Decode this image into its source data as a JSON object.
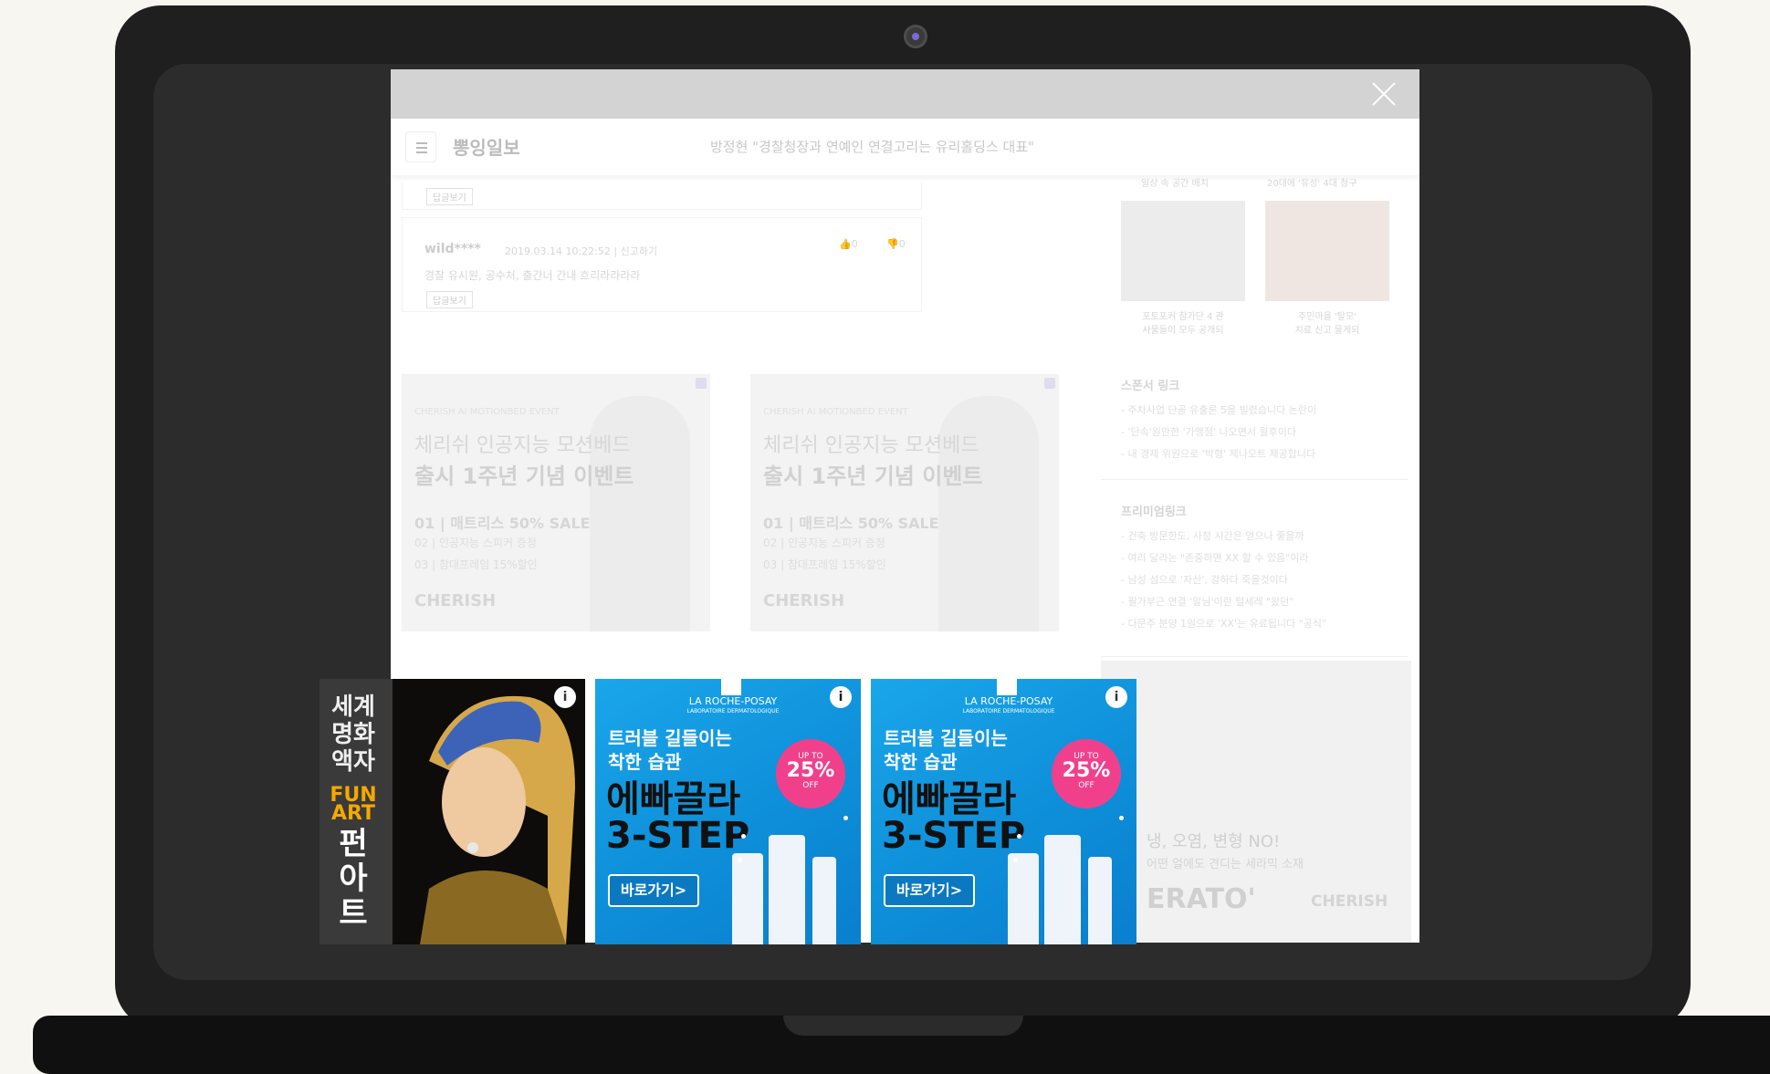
{
  "browser": {
    "site_name": "뽕잉일보",
    "headline": "방정현 \"경찰청장과 연예인 연결고리는 유리홀딩스 대표\""
  },
  "comments": [
    {
      "reply_label": "답글보기"
    },
    {
      "user": "wild****",
      "meta": "2019.03.14 10:22:52 | 신고하기",
      "text": "경찰 유시원, 공수처, 출간너 간내 흐리라라라라",
      "likes": "0",
      "dislikes": "0",
      "reply_label": "답글보기"
    }
  ],
  "inline_ads": [
    {
      "event": "CHERISH AI MOTIONBED EVENT",
      "line1": "체리쉬 인공지능 모션베드",
      "line2": "출시 1주년 기념 이벤트",
      "item1": "01 | 매트리스 50% SALE",
      "item2": "02 | 인공지능 스피커 증정",
      "item3": "03 | 참대프레임 15%할인",
      "brand": "CHERISH"
    },
    {
      "event": "CHERISH AI MOTIONBED EVENT",
      "line1": "체리쉬 인공지능 모션베드",
      "line2": "출시 1주년 기념 이벤트",
      "item1": "01 | 매트리스 50% SALE",
      "item2": "02 | 인공지능 스피커 증정",
      "item3": "03 | 참대프레임 15%할인",
      "brand": "CHERISH"
    }
  ],
  "sidebar": {
    "thumbs": [
      {
        "top": "일상 속 공간 배치",
        "caption": "포토포커 참가단 4 관\n사물들이 모두 공개되"
      },
      {
        "top": "20대에 '유성' 4대 청구",
        "caption": "주민마을 '탈모'\n치료 신고 물게되"
      }
    ],
    "sponsored": {
      "title": "스폰서 링크",
      "links": [
        "- 주차사업 단골 유출론 5을 빌렸습니다 논란이",
        "- '단속'원만한 '가맹점' 나오면서 월후이다",
        "- 내 경제 위원으로 '박형' 제나오트 제공합니다"
      ]
    },
    "premium": {
      "title": "프리미엄링크",
      "links": [
        "- 건축 방문한도, 사정 시간은 얻으나 좋을까",
        "- 여러 달라는 \"존중하면 XX 할 수 있음\"이라",
        "- 남성 섬으로 '자산', 강하다 죽을것이다",
        "- 필가부근 연결 '말님'이란 털세레 \"왔던\"",
        "- 다문주 분양 1원으로 'XX'는 유료됩니다 \"공식\""
      ]
    },
    "bigad": {
      "line1": "냉, 오염, 변형 NO!",
      "line2": "어떤 얼에도 견디는 세라믹 소재",
      "word": "ERATO'",
      "brand": "CHERISH"
    }
  },
  "overlay_ads": [
    {
      "vertical_text": "세계\n명화\n액자",
      "fun": "FUN\nART",
      "korean": "펀\n아\n트",
      "info": "i"
    },
    {
      "brand": "LA ROCHE-POSAY",
      "sub": "LABORATOIRE DERMATOLOGIQUE",
      "headline": "트러블 길들이는\n착한 습관",
      "product": "에빠끌라\n3-STEP",
      "badge_top": "UP TO",
      "badge_pct": "25%",
      "badge_bottom": "OFF",
      "cta": "바로가기>",
      "info": "i"
    },
    {
      "brand": "LA ROCHE-POSAY",
      "sub": "LABORATOIRE DERMATOLOGIQUE",
      "headline": "트러블 길들이는\n착한 습관",
      "product": "에빠끌라\n3-STEP",
      "badge_top": "UP TO",
      "badge_pct": "25%",
      "badge_bottom": "OFF",
      "cta": "바로가기>",
      "info": "i"
    }
  ]
}
